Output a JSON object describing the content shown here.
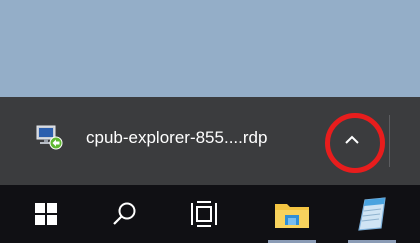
{
  "download_bar": {
    "item": {
      "filename": "cpub-explorer-855....rdp",
      "icon": "remote-desktop-icon"
    },
    "show_more_icon": "chevron-up-icon",
    "highlight_color": "#e81d1d"
  },
  "taskbar": {
    "start_icon": "windows-logo-icon",
    "search_icon": "search-icon",
    "task_view_icon": "task-view-icon",
    "pinned_apps": [
      {
        "name": "File Explorer",
        "icon": "folder-icon",
        "running": true
      },
      {
        "name": "Notepad",
        "icon": "notepad-icon",
        "running": true
      }
    ]
  },
  "colors": {
    "desktop": "#94aec8",
    "download_bar": "#3b3c3e",
    "taskbar": "#101014"
  }
}
